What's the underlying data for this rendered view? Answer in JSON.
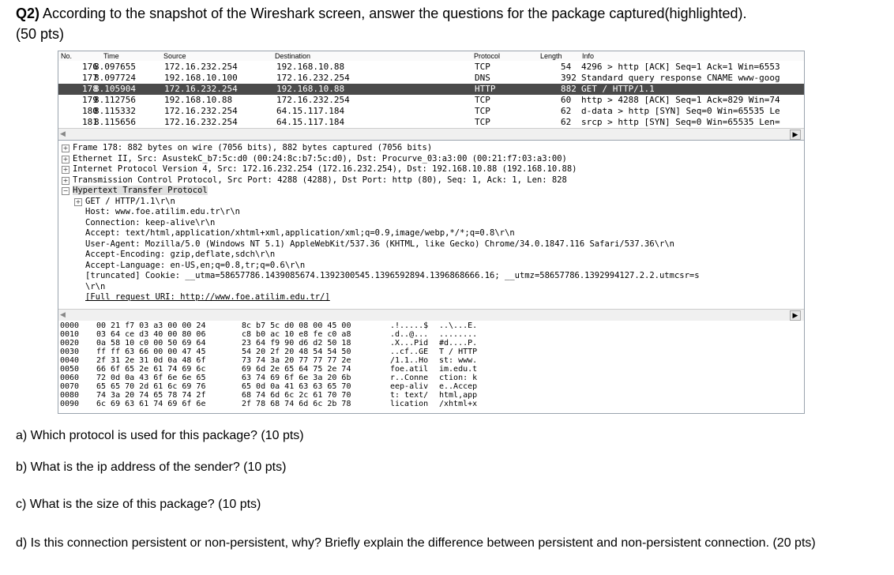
{
  "question": {
    "number": "Q2)",
    "text": " According to the snapshot of the Wireshark screen, answer the questions for the package captured(highlighted).",
    "points": "(50 pts)"
  },
  "packet_list": {
    "columns": [
      "No.",
      "Time",
      "Source",
      "Destination",
      "Protocol",
      "Length",
      "Info"
    ],
    "rows": [
      {
        "no": "176",
        "time": "8.097655",
        "src": "172.16.232.254",
        "dst": "192.168.10.88",
        "proto": "TCP",
        "len": "54",
        "info": "4296 > http [ACK] Seq=1 Ack=1 Win=6553"
      },
      {
        "no": "177",
        "time": "8.097724",
        "src": "192.168.10.100",
        "dst": "172.16.232.254",
        "proto": "DNS",
        "len": "392",
        "info": "Standard query response CNAME www-goog"
      },
      {
        "no": "178",
        "time": "8.105904",
        "src": "172.16.232.254",
        "dst": "192.168.10.88",
        "proto": "HTTP",
        "len": "882",
        "info": "GET / HTTP/1.1"
      },
      {
        "no": "179",
        "time": "8.112756",
        "src": "192.168.10.88",
        "dst": "172.16.232.254",
        "proto": "TCP",
        "len": "60",
        "info": "http > 4288 [ACK] Seq=1 Ack=829 Win=74"
      },
      {
        "no": "180",
        "time": "8.115332",
        "src": "172.16.232.254",
        "dst": "64.15.117.184",
        "proto": "TCP",
        "len": "62",
        "info": "d-data > http [SYN] Seq=0 Win=65535 Le"
      },
      {
        "no": "181",
        "time": "8.115656",
        "src": "172.16.232.254",
        "dst": "64.15.117.184",
        "proto": "TCP",
        "len": "62",
        "info": "srcp > http [SYN] Seq=0 Win=65535 Len="
      }
    ],
    "selected_index": 2
  },
  "details": {
    "lines": [
      "Frame 178: 882 bytes on wire (7056 bits), 882 bytes captured (7056 bits)",
      "Ethernet II, Src: AsustekC_b7:5c:d0 (00:24:8c:b7:5c:d0), Dst: Procurve_03:a3:00 (00:21:f7:03:a3:00)",
      "Internet Protocol Version 4, Src: 172.16.232.254 (172.16.232.254), Dst: 192.168.10.88 (192.168.10.88)",
      "Transmission Control Protocol, Src Port: 4288 (4288), Dst Port: http (80), Seq: 1, Ack: 1, Len: 828",
      "Hypertext Transfer Protocol",
      "GET / HTTP/1.1\\r\\n",
      "Host: www.foe.atilim.edu.tr\\r\\n",
      "Connection: keep-alive\\r\\n",
      "Accept: text/html,application/xhtml+xml,application/xml;q=0.9,image/webp,*/*;q=0.8\\r\\n",
      "User-Agent: Mozilla/5.0 (Windows NT 5.1) AppleWebKit/537.36 (KHTML, like Gecko) Chrome/34.0.1847.116 Safari/537.36\\r\\n",
      "Accept-Encoding: gzip,deflate,sdch\\r\\n",
      "Accept-Language: en-US,en;q=0.8,tr;q=0.6\\r\\n",
      "[truncated] Cookie: __utma=58657786.1439085674.1392300545.1396592894.1396868666.16; __utmz=58657786.1392994127.2.2.utmcsr=s",
      "\\r\\n",
      "[Full request URI: http://www.foe.atilim.edu.tr/]"
    ]
  },
  "hex_dump": {
    "rows": [
      {
        "off": "0000",
        "h1": "00 21 f7 03 a3 00 00 24",
        "h2": "8c b7 5c d0 08 00 45 00",
        "a1": ".!.....$",
        "a2": "..\\...E."
      },
      {
        "off": "0010",
        "h1": "03 64 ce d3 40 00 80 06",
        "h2": "c8 b0 ac 10 e8 fe c0 a8",
        "a1": ".d..@...",
        "a2": "........"
      },
      {
        "off": "0020",
        "h1": "0a 58 10 c0 00 50 69 64",
        "h2": "23 64 f9 90 d6 d2 50 18",
        "a1": ".X...Pid",
        "a2": "#d....P."
      },
      {
        "off": "0030",
        "h1": "ff ff 63 66 00 00 47 45",
        "h2": "54 20 2f 20 48 54 54 50",
        "a1": "..cf..GE",
        "a2": "T / HTTP"
      },
      {
        "off": "0040",
        "h1": "2f 31 2e 31 0d 0a 48 6f",
        "h2": "73 74 3a 20 77 77 77 2e",
        "a1": "/1.1..Ho",
        "a2": "st: www."
      },
      {
        "off": "0050",
        "h1": "66 6f 65 2e 61 74 69 6c",
        "h2": "69 6d 2e 65 64 75 2e 74",
        "a1": "foe.atil",
        "a2": "im.edu.t"
      },
      {
        "off": "0060",
        "h1": "72 0d 0a 43 6f 6e 6e 65",
        "h2": "63 74 69 6f 6e 3a 20 6b",
        "a1": "r..Conne",
        "a2": "ction: k"
      },
      {
        "off": "0070",
        "h1": "65 65 70 2d 61 6c 69 76",
        "h2": "65 0d 0a 41 63 63 65 70",
        "a1": "eep-aliv",
        "a2": "e..Accep"
      },
      {
        "off": "0080",
        "h1": "74 3a 20 74 65 78 74 2f",
        "h2": "68 74 6d 6c 2c 61 70 70",
        "a1": "t: text/",
        "a2": "html,app"
      },
      {
        "off": "0090",
        "h1": "6c 69 63 61 74 69 6f 6e",
        "h2": "2f 78 68 74 6d 6c 2b 78",
        "a1": "lication",
        "a2": "/xhtml+x"
      }
    ]
  },
  "questions": {
    "a": "a) Which protocol is used for this package? (10 pts)",
    "b": "b) What is the ip address of the sender? (10 pts)",
    "c": "c) What is the size of this package? (10 pts)",
    "d": "d) Is this connection persistent or non-persistent, why? Briefly explain the difference between persistent and non-persistent connection. (20 pts)"
  }
}
